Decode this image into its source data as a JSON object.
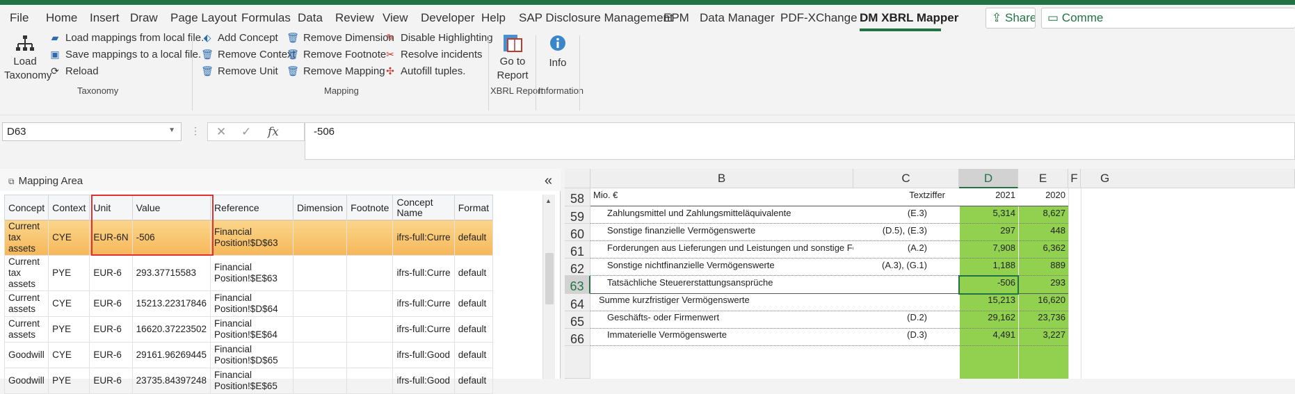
{
  "menu": {
    "items": [
      "File",
      "Home",
      "Insert",
      "Draw",
      "Page Layout",
      "Formulas",
      "Data",
      "Review",
      "View",
      "Developer",
      "Help",
      "SAP Disclosure Management",
      "EPM",
      "Data Manager",
      "PDF-XChange",
      "DM XBRL Mapper"
    ],
    "active": "DM XBRL Mapper",
    "share_label": "Share",
    "comments_label": "Comme"
  },
  "ribbon": {
    "taxonomy": {
      "load_label": "Load Taxonomy",
      "load_mappings": "Load mappings from local file.",
      "save_mappings": "Save mappings to a local file.",
      "reload": "Reload",
      "group_label": "Taxonomy"
    },
    "mapping": {
      "add_concept": "Add Concept",
      "remove_context": "Remove Context",
      "remove_unit": "Remove Unit",
      "remove_dimension": "Remove Dimension",
      "remove_footnote": "Remove Footnote",
      "remove_mapping": "Remove Mapping",
      "disable_highlighting": "Disable Highlighting",
      "resolve_incidents": "Resolve incidents",
      "autofill_tuples": "Autofill tuples.",
      "group_label": "Mapping"
    },
    "xbrl_report": {
      "goto_label": "Go to Report",
      "group_label": "XBRL Report"
    },
    "information": {
      "info_label": "Info",
      "group_label": "Information"
    }
  },
  "formula_bar": {
    "name_box": "D63",
    "formula": "-506",
    "fx": "fx"
  },
  "mapping_area": {
    "title": "Mapping Area",
    "collapse": "«",
    "columns": [
      "Concept",
      "Context",
      "Unit",
      "Value",
      "Reference",
      "Dimension",
      "Footnote",
      "Concept Name",
      "Format"
    ],
    "rows": [
      {
        "concept": "Current tax assets",
        "context": "CYE",
        "unit": "EUR-6N",
        "value": "-506",
        "reference": "Financial Position!$D$63",
        "dimension": "",
        "footnote": "",
        "concept_name": "ifrs-full:Curre",
        "format": "default"
      },
      {
        "concept": "Current tax assets",
        "context": "PYE",
        "unit": "EUR-6",
        "value": "293.37715583",
        "reference": "Financial Position!$E$63",
        "dimension": "",
        "footnote": "",
        "concept_name": "ifrs-full:Curre",
        "format": "default"
      },
      {
        "concept": "Current assets",
        "context": "CYE",
        "unit": "EUR-6",
        "value": "15213.22317846",
        "reference": "Financial Position!$D$64",
        "dimension": "",
        "footnote": "",
        "concept_name": "ifrs-full:Curre",
        "format": "default"
      },
      {
        "concept": "Current assets",
        "context": "PYE",
        "unit": "EUR-6",
        "value": "16620.37223502",
        "reference": "Financial Position!$E$64",
        "dimension": "",
        "footnote": "",
        "concept_name": "ifrs-full:Curre",
        "format": "default"
      },
      {
        "concept": "Goodwill",
        "context": "CYE",
        "unit": "EUR-6",
        "value": "29161.96269445",
        "reference": "Financial Position!$D$65",
        "dimension": "",
        "footnote": "",
        "concept_name": "ifrs-full:Good",
        "format": "default"
      },
      {
        "concept": "Goodwill",
        "context": "PYE",
        "unit": "EUR-6",
        "value": "23735.84397248",
        "reference": "Financial Position!$E$65",
        "dimension": "",
        "footnote": "",
        "concept_name": "ifrs-full:Good",
        "format": "default"
      }
    ]
  },
  "sheet": {
    "columns": [
      "B",
      "C",
      "D",
      "E",
      "F",
      "G"
    ],
    "selected_column": "D",
    "selected_row": "63",
    "rows": [
      {
        "num": "58",
        "b": "Mio. €",
        "c": "Textziffer",
        "d": "2021",
        "e": "2020",
        "indent": false
      },
      {
        "num": "59",
        "b": "Zahlungsmittel und Zahlungsmitteläquivalente",
        "c": "(E.3)",
        "d": "5,314",
        "e": "8,627",
        "indent": true
      },
      {
        "num": "60",
        "b": "Sonstige finanzielle Vermögenswerte",
        "c": "(D.5), (E.3)",
        "d": "297",
        "e": "448",
        "indent": true
      },
      {
        "num": "61",
        "b": "Forderungen aus Lieferungen und Leistungen und sonstige Forderungen",
        "c": "(A.2)",
        "d": "7,908",
        "e": "6,362",
        "indent": true
      },
      {
        "num": "62",
        "b": "Sonstige nichtfinanzielle Vermögenswerte",
        "c": "(A.3), (G.1)",
        "d": "1,188",
        "e": "889",
        "indent": true
      },
      {
        "num": "63",
        "b": "Tatsächliche Steuererstattungsansprüche",
        "c": "",
        "d": "-506",
        "e": "293",
        "indent": true
      },
      {
        "num": "64",
        "b": "Summe kurzfristiger Vermögenswerte",
        "c": "",
        "d": "15,213",
        "e": "16,620",
        "indent": false
      },
      {
        "num": "65",
        "b": "Geschäfts- oder Firmenwert",
        "c": "(D.2)",
        "d": "29,162",
        "e": "23,736",
        "indent": true
      },
      {
        "num": "66",
        "b": "Immaterielle Vermögenswerte",
        "c": "(D.3)",
        "d": "4,491",
        "e": "3,227",
        "indent": true
      }
    ]
  },
  "colors": {
    "excel_green": "#217346",
    "cell_green": "#92d050",
    "selected_row": "#f6b759",
    "highlight_red": "#e03030"
  }
}
